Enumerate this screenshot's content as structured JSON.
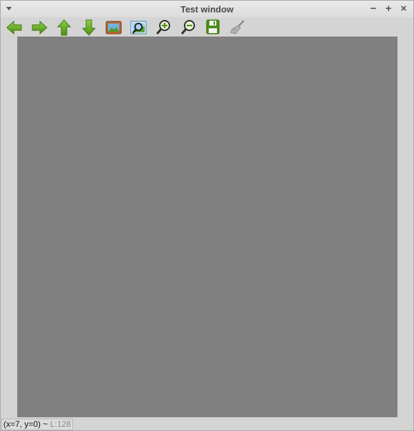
{
  "window": {
    "title": "Test window",
    "controls": {
      "minimize": "−",
      "maximize": "+",
      "close": "×"
    }
  },
  "toolbar": {
    "buttons": [
      {
        "icon": "arrow-left-icon",
        "color": "#5fa81f"
      },
      {
        "icon": "arrow-right-icon",
        "color": "#5fa81f"
      },
      {
        "icon": "arrow-up-icon",
        "color": "#5fa81f"
      },
      {
        "icon": "arrow-down-icon",
        "color": "#5fa81f"
      },
      {
        "icon": "image-icon",
        "color": "#b7652a"
      },
      {
        "icon": "zoom-fit-icon",
        "color": "#3a8fd1"
      },
      {
        "icon": "zoom-in-icon",
        "color": "#5fa81f"
      },
      {
        "icon": "zoom-out-icon",
        "color": "#5fa81f"
      },
      {
        "icon": "save-icon",
        "color": "#5fa81f"
      },
      {
        "icon": "clear-brush-icon",
        "color": "#9a9a9a"
      }
    ]
  },
  "canvas": {
    "fill_color": "#808080"
  },
  "status": {
    "coords": "(x=7, y=0) ~ ",
    "level": "L:128"
  }
}
